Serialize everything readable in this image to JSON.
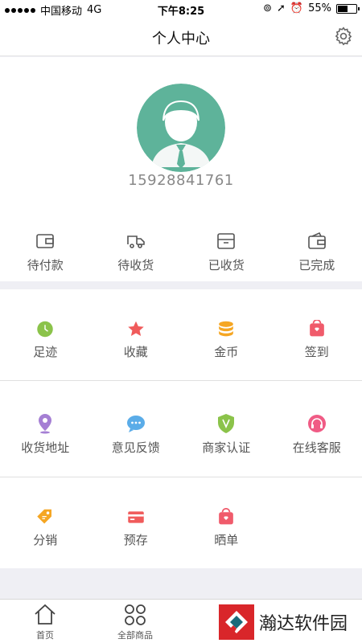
{
  "status_bar": {
    "carrier": "中国移动",
    "network": "4G",
    "time": "下午8:25",
    "battery": "55%",
    "battery_level": 0.55
  },
  "header": {
    "title": "个人中心",
    "settings_icon": "gear-icon"
  },
  "profile": {
    "phone": "15928841761",
    "avatar_color": "#5eb39a"
  },
  "orders": [
    {
      "label": "待付款",
      "icon": "wallet-icon"
    },
    {
      "label": "待收货",
      "icon": "truck-icon"
    },
    {
      "label": "已收货",
      "icon": "inbox-icon"
    },
    {
      "label": "已完成",
      "icon": "purse-icon"
    }
  ],
  "grid": [
    [
      {
        "label": "足迹",
        "icon": "clock-icon",
        "color": "#8bc34a"
      },
      {
        "label": "收藏",
        "icon": "star-icon",
        "color": "#f05b5b"
      },
      {
        "label": "金币",
        "icon": "coins-icon",
        "color": "#f5a623"
      },
      {
        "label": "签到",
        "icon": "checkin-icon",
        "color": "#f05b6b"
      }
    ],
    [
      {
        "label": "收货地址",
        "icon": "location-icon",
        "color": "#a57fd4"
      },
      {
        "label": "意见反馈",
        "icon": "chat-icon",
        "color": "#5aace8"
      },
      {
        "label": "商家认证",
        "icon": "shield-icon",
        "color": "#8bc34a"
      },
      {
        "label": "在线客服",
        "icon": "headset-icon",
        "color": "#f05b85"
      }
    ],
    [
      {
        "label": "分销",
        "icon": "tag-icon",
        "color": "#f5a623"
      },
      {
        "label": "预存",
        "icon": "card-icon",
        "color": "#f05b5b"
      },
      {
        "label": "晒单",
        "icon": "bag-icon",
        "color": "#f05b6b"
      }
    ]
  ],
  "tabbar": {
    "home": "首页",
    "all_products": "全部商品"
  },
  "watermark": {
    "text": "瀚达软件园"
  }
}
